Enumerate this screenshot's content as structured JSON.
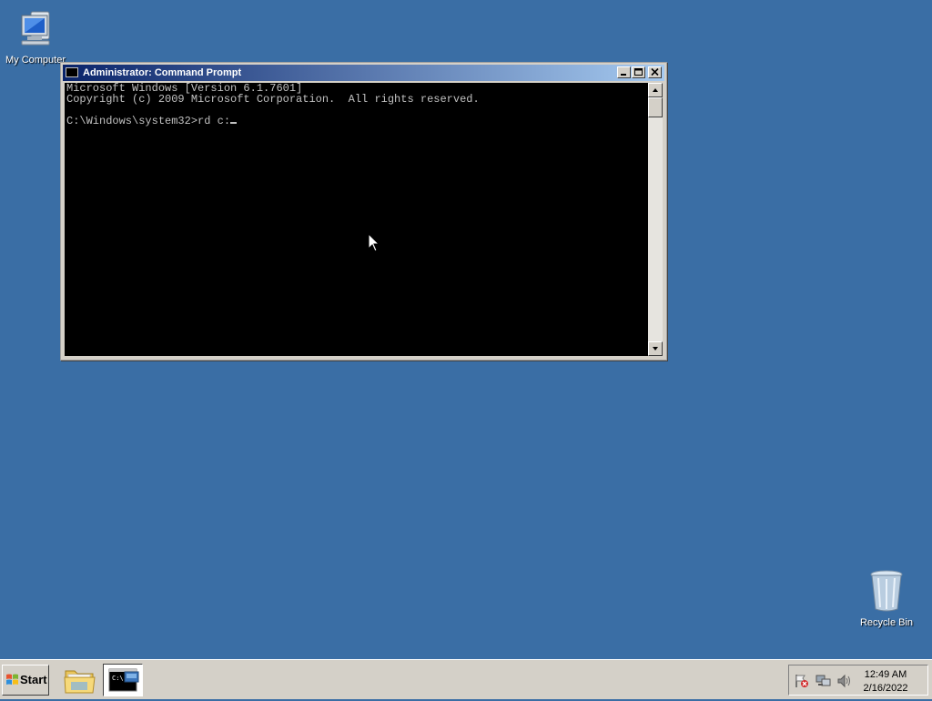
{
  "desktop": {
    "icons": [
      {
        "label": "My Computer"
      },
      {
        "label": "Recycle Bin"
      }
    ]
  },
  "cmd_window": {
    "title": "Administrator: Command Prompt",
    "lines": [
      "Microsoft Windows [Version 6.1.7601]",
      "Copyright (c) 2009 Microsoft Corporation.  All rights reserved.",
      "",
      "C:\\Windows\\system32>rd c:"
    ]
  },
  "taskbar": {
    "start_label": "Start",
    "clock": {
      "time": "12:49 AM",
      "date": "2/16/2022"
    }
  },
  "colors": {
    "desktop_bg": "#3a6ea5",
    "console_bg": "#000000",
    "console_text": "#c0c0c0",
    "titlebar_start": "#0a246a",
    "titlebar_end": "#a6caf0"
  },
  "icons": [
    "computer-icon",
    "recycle-bin-icon",
    "cmd-icon",
    "minimize-icon",
    "maximize-icon",
    "close-icon",
    "windows-flag-icon",
    "folder-icon",
    "action-center-flag-icon",
    "network-icon",
    "volume-icon",
    "show-desktop-icon",
    "mouse-pointer-icon"
  ]
}
